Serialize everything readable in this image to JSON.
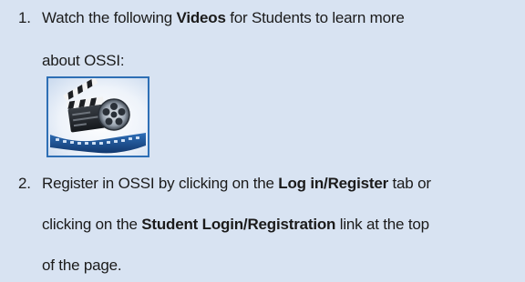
{
  "steps": [
    {
      "number": "1.",
      "line1_pre": "Watch the following ",
      "line1_bold": "Videos",
      "line1_post": " for Students to learn more",
      "line2": "about OSSI:",
      "thumbnail_icon": "film-clapperboard-reel-icon"
    },
    {
      "number": "2.",
      "line1_pre": "Register in OSSI by clicking on the ",
      "line1_bold": "Log in/Register",
      "line1_post": " tab or",
      "line2_pre": "clicking on the ",
      "line2_bold": "Student Login/Registration",
      "line2_post": " link at the top",
      "line3": "of the page."
    }
  ],
  "colors": {
    "background": "#d8e3f2",
    "thumbnail_border": "#2e6fb5",
    "text": "#1b1b1b"
  }
}
